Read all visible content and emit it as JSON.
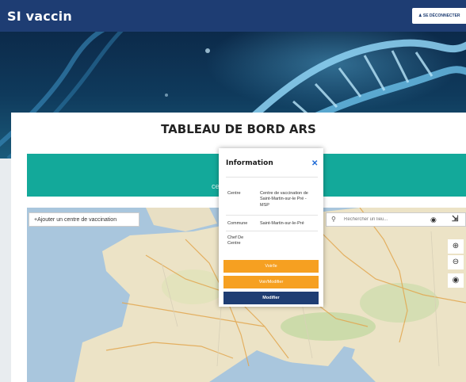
{
  "app": {
    "title": "SI vaccin",
    "logout_label": "SE DÉCONNECTER"
  },
  "dashboard": {
    "title": "TABLEAU DE BORD ARS",
    "banner_text": "cen"
  },
  "map": {
    "add_center_label": "+Ajouter un centre de vaccination",
    "search_placeholder": "Rechercher un lieu..."
  },
  "popup": {
    "title": "Information",
    "rows": [
      {
        "label": "Centre",
        "value": "Centre de vaccination de Saint-Martin-sur-le Pré - MSP"
      },
      {
        "label": "Commune",
        "value": "Saint-Martin-sur-le-Pré"
      },
      {
        "label": "Chef De Centre",
        "value": ""
      }
    ],
    "buttons": {
      "b1": "Voir/le",
      "b2": "Voir/Modifier",
      "modify": "Modifier"
    }
  },
  "colors": {
    "navy": "#1e3d73",
    "teal": "#13a99a",
    "orange": "#f6a021",
    "link_blue": "#1e6ad6"
  },
  "icons": [
    "user-icon",
    "plus-icon",
    "search-icon",
    "binoculars-icon",
    "fullscreen-icon",
    "zoom-in-icon",
    "zoom-out-icon",
    "globe-icon",
    "close-icon"
  ]
}
